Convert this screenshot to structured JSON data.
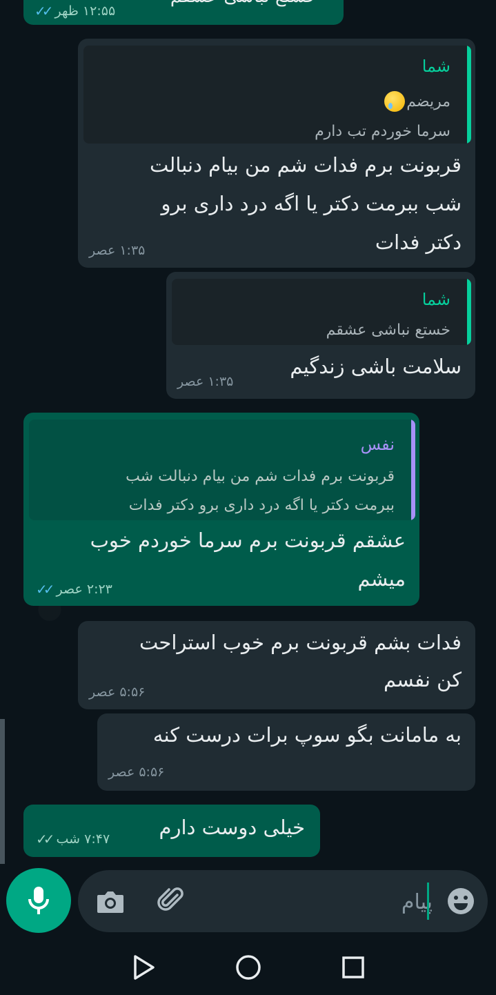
{
  "messages": [
    {
      "id": "top",
      "direction": "out",
      "time": "۱۲:۵۵ ظهر",
      "partial_text": "خستع نباشی عشقم"
    },
    {
      "id": "m1",
      "direction": "in",
      "quote": {
        "sender": "شما",
        "lines": [
          "مریضم",
          "سرما خوردم تب دارم"
        ],
        "emoji": "crying-face"
      },
      "lines": [
        "قربونت برم فدات شم  من بیام دنبالت",
        "شب ببرمت دکتر یا اگه درد داری برو",
        "دکتر فدات"
      ],
      "time": "۱:۳۵ عصر"
    },
    {
      "id": "m2",
      "direction": "in",
      "quote": {
        "sender": "شما",
        "lines": [
          "خستع نباشی عشقم"
        ]
      },
      "lines": [
        "سلامت باشی زندگیم"
      ],
      "time": "۱:۳۵ عصر"
    },
    {
      "id": "m3",
      "direction": "out",
      "quote": {
        "sender": "نفس",
        "lines": [
          "قربونت برم فدات شم  من بیام دنبالت شب",
          "ببرمت دکتر یا اگه درد داری برو دکتر فدات"
        ]
      },
      "lines": [
        "عشقم قربونت برم سرما خوردم خوب",
        "میشم"
      ],
      "time": "۲:۲۳ عصر"
    },
    {
      "id": "m4",
      "direction": "in",
      "lines": [
        "فدات بشم قربونت برم خوب استراحت",
        "کن نفسم"
      ],
      "time": "۵:۵۶ عصر"
    },
    {
      "id": "m5",
      "direction": "in",
      "lines": [
        "به مامانت بگو سوپ برات درست کنه"
      ],
      "time": "۵:۵۶ عصر"
    },
    {
      "id": "m6",
      "direction": "out",
      "lines": [
        "خیلی دوست دارم"
      ],
      "time": "۷:۴۷ شب"
    }
  ],
  "input": {
    "placeholder": "پیام"
  },
  "colors": {
    "incoming": "#202c33",
    "outgoing": "#005c4b",
    "accent": "#00a884",
    "read_ticks": "#53bdeb",
    "quote_self": "#06cf9c",
    "quote_other": "#a791f7"
  },
  "icons": {
    "mic": "mic-icon",
    "camera": "camera-icon",
    "attach": "paperclip-icon",
    "emoji": "emoji-icon",
    "back": "nav-back-icon",
    "home": "nav-home-icon",
    "recents": "nav-recents-icon"
  }
}
